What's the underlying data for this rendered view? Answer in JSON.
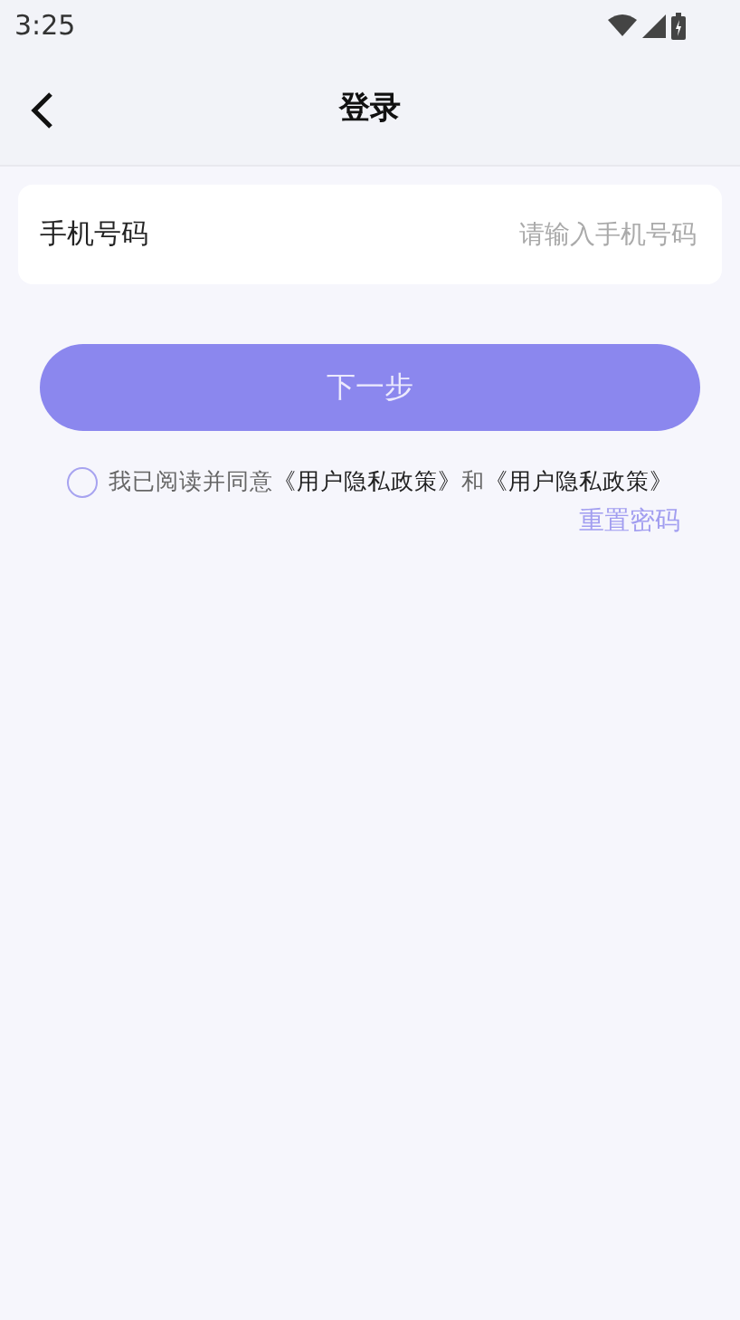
{
  "status_bar": {
    "time": "3:25"
  },
  "header": {
    "title": "登录"
  },
  "phone_field": {
    "label": "手机号码",
    "placeholder": "请输入手机号码"
  },
  "next_button": {
    "label": "下一步",
    "disabled": true
  },
  "agreement": {
    "checked": false,
    "text": "我已阅读并同意",
    "links": [
      "《用户隐私政策》",
      "《用户隐私政策》"
    ],
    "joiner": "和"
  },
  "reset_link": "重置密码"
}
